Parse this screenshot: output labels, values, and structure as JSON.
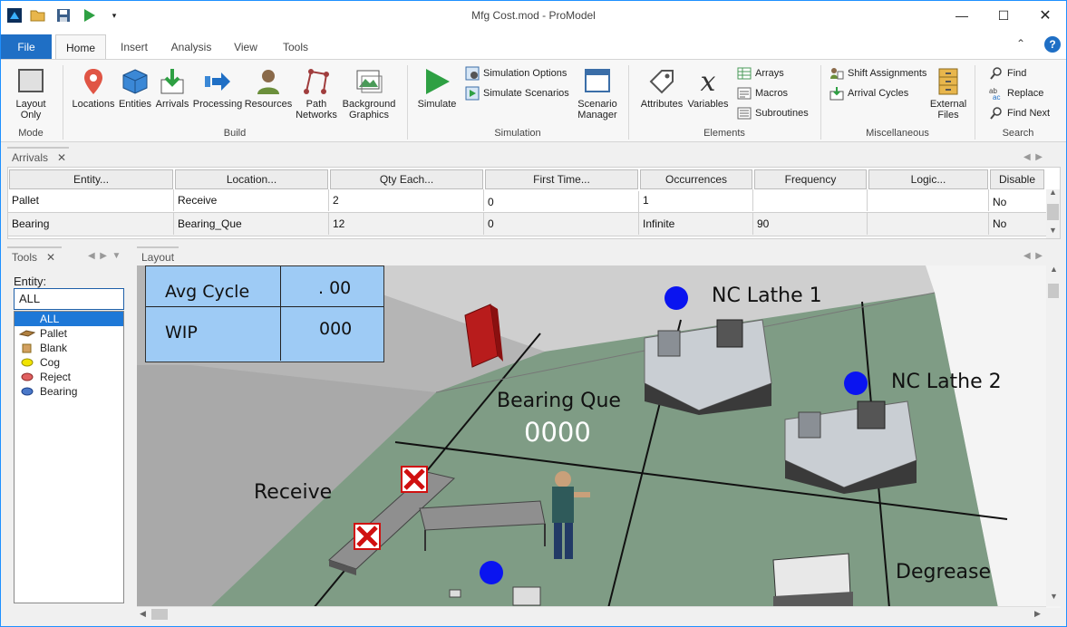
{
  "window": {
    "title": "Mfg Cost.mod - ProModel"
  },
  "ribbon_tabs": [
    "File",
    "Home",
    "Insert",
    "Analysis",
    "View",
    "Tools"
  ],
  "ribbon": {
    "mode": {
      "layout_only": "Layout\nOnly",
      "group": "Mode"
    },
    "build": {
      "locations": "Locations",
      "entities": "Entities",
      "arrivals": "Arrivals",
      "processing": "Processing",
      "resources": "Resources",
      "path_networks": "Path\nNetworks",
      "background_graphics": "Background\nGraphics",
      "group": "Build"
    },
    "simulation": {
      "simulate": "Simulate",
      "simulation_options": "Simulation Options",
      "simulate_scenarios": "Simulate Scenarios",
      "scenario_manager": "Scenario\nManager",
      "group": "Simulation"
    },
    "elements": {
      "attributes": "Attributes",
      "variables": "Variables",
      "arrays": "Arrays",
      "macros": "Macros",
      "subroutines": "Subroutines",
      "group": "Elements"
    },
    "misc": {
      "shift_assignments": "Shift Assignments",
      "arrival_cycles": "Arrival Cycles",
      "external_files": "External\nFiles",
      "group": "Miscellaneous"
    },
    "search": {
      "find": "Find",
      "replace": "Replace",
      "find_next": "Find Next",
      "group": "Search"
    }
  },
  "arrivals_panel": {
    "tab": "Arrivals",
    "columns": [
      "Entity...",
      "Location...",
      "Qty Each...",
      "First Time...",
      "Occurrences",
      "Frequency",
      "Logic...",
      "Disable"
    ],
    "rows": [
      [
        "Pallet",
        "Receive",
        "2",
        "0",
        "1",
        "",
        "",
        "No"
      ],
      [
        "Bearing",
        "Bearing_Que",
        "12",
        "0",
        "Infinite",
        "90",
        "",
        "No"
      ]
    ]
  },
  "tools_panel": {
    "tab": "Tools",
    "entity_label": "Entity:",
    "entity_value": "ALL",
    "entities": [
      "ALL",
      "Pallet",
      "Blank",
      "Cog",
      "Reject",
      "Bearing"
    ]
  },
  "layout_panel": {
    "tab": "Layout",
    "stats": {
      "avg_cycle_label": "Avg Cycle",
      "avg_cycle_value": ". 00",
      "wip_label": "WIP",
      "wip_value": "000"
    },
    "labels": {
      "nc_lathe_1": "NC Lathe 1",
      "nc_lathe_2": "NC Lathe 2",
      "bearing_que": "Bearing Que",
      "bearing_que_count": "0000",
      "receive": "Receive",
      "degrease": "Degrease"
    }
  },
  "colors": {
    "accent": "#1f6fc5",
    "floor": "#7f9c85",
    "stats_bg": "#9ecbf5",
    "status_dot": "#0a14f0"
  }
}
